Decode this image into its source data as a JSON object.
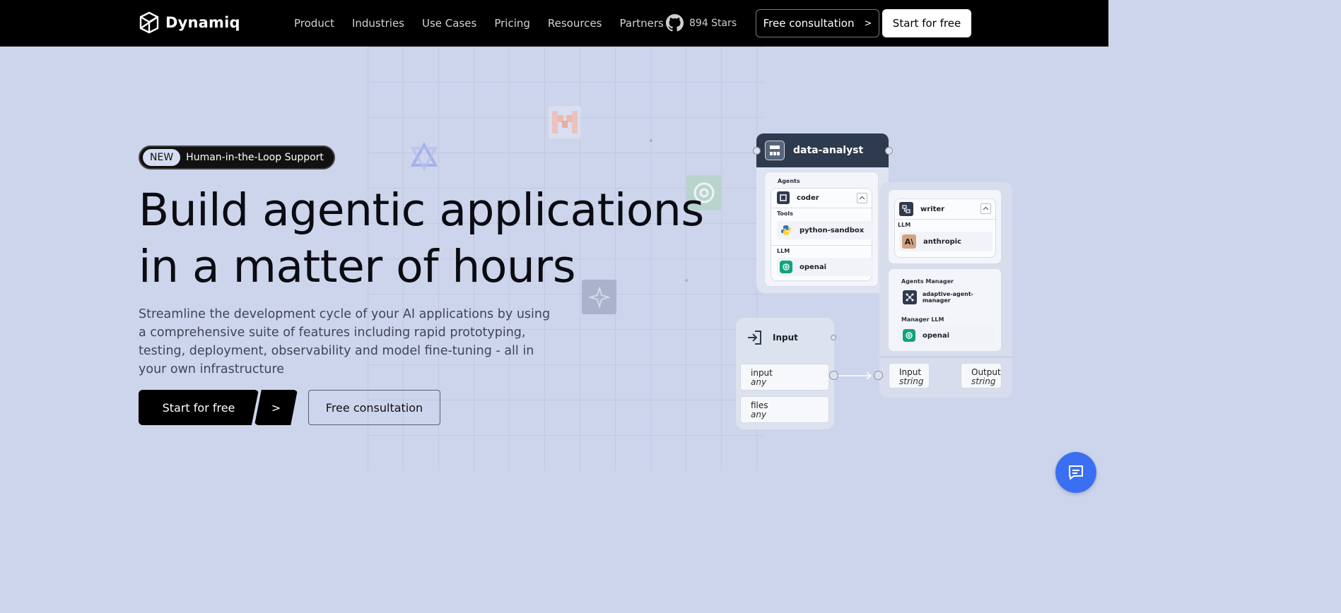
{
  "header": {
    "logo_text": "Dynamiq",
    "nav": [
      "Product",
      "Industries",
      "Use Cases",
      "Pricing",
      "Resources",
      "Partners"
    ],
    "github_stars": "894 Stars",
    "consult_label": "Free consultation",
    "start_label": "Start for free"
  },
  "hero": {
    "badge_new": "NEW",
    "badge_text": "Human-in-the-Loop Support",
    "headline_line1": "Build agentic applications",
    "headline_line2": "in a matter of hours",
    "subtext": "Streamline the development cycle of your AI applications by using a comprehensive suite of features including rapid prototyping, testing, deployment, observability and model fine-tuning - all in your own infrastructure",
    "cta_start": "Start for free",
    "cta_consult": "Free consultation"
  },
  "diagram": {
    "analyst": {
      "title": "data-analyst",
      "agents_label": "Agents",
      "agent": "coder",
      "tools_label": "Tools",
      "tool": "python-sandbox",
      "llm_label": "LLM",
      "llm": "openai"
    },
    "writer": {
      "title": "writer",
      "llm_label": "LLM",
      "llm": "anthropic"
    },
    "manager": {
      "agents_manager_label": "Agents Manager",
      "agents_manager": "adaptive-agent-manager",
      "manager_llm_label": "Manager LLM",
      "manager_llm": "openai"
    },
    "input_node": {
      "title": "Input",
      "fields": [
        {
          "name": "input",
          "type": "any"
        },
        {
          "name": "files",
          "type": "any"
        }
      ]
    },
    "io": {
      "input_label": "Input",
      "input_type": "string",
      "output_label": "Output",
      "output_type": "string"
    }
  },
  "colors": {
    "background": "#cdd5ec",
    "header": "#000000",
    "dark_panel": "#2e3a4d",
    "chat_button": "#3b6ff2",
    "openai_green": "#10a37f",
    "anthropic_tan": "#d4a27f"
  },
  "icons": {
    "logo": "dynamiq-cube-icon",
    "github": "github-icon",
    "chat": "chat-bubble-icon"
  }
}
